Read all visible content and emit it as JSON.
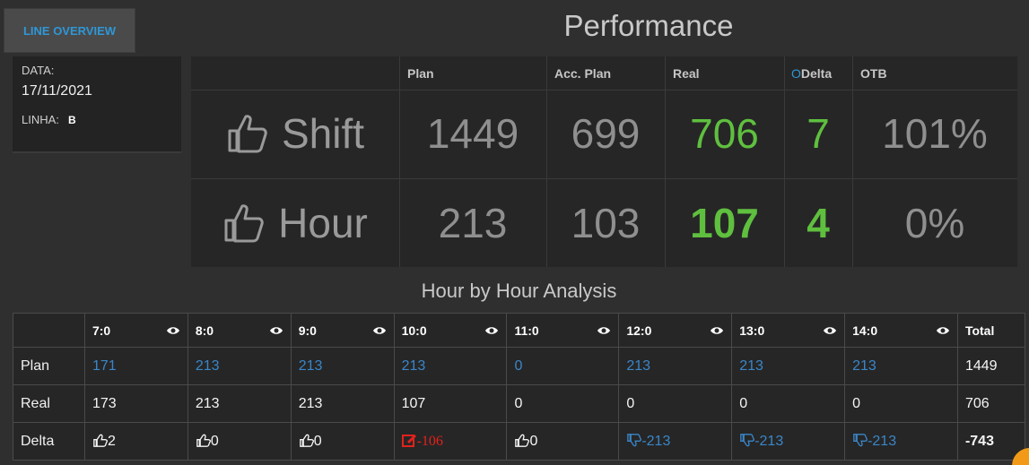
{
  "nav": {
    "overview_label": "LINE OVERVIEW"
  },
  "title": "Performance",
  "info": {
    "data_label": "DATA:",
    "data_value": "17/11/2021",
    "linha_label": "LINHA:",
    "linha_value": "B"
  },
  "performance": {
    "columns": [
      "Plan",
      "Acc. Plan",
      "Real",
      "Delta",
      "OTB"
    ],
    "delta_prefix": "O",
    "rows": [
      {
        "name": "Shift",
        "plan": "1449",
        "acc_plan": "699",
        "real": "706",
        "delta": "7",
        "otb": "101%"
      },
      {
        "name": "Hour",
        "plan": "213",
        "acc_plan": "103",
        "real": "107",
        "delta": "4",
        "otb": "0%"
      }
    ]
  },
  "hourly": {
    "title": "Hour by Hour Analysis",
    "hours": [
      "7:0",
      "8:0",
      "9:0",
      "10:0",
      "11:0",
      "12:0",
      "13:0",
      "14:0"
    ],
    "total_label": "Total",
    "rows": {
      "plan": {
        "label": "Plan",
        "values": [
          "171",
          "213",
          "213",
          "213",
          "0",
          "213",
          "213",
          "213"
        ],
        "total": "1449"
      },
      "real": {
        "label": "Real",
        "values": [
          "173",
          "213",
          "213",
          "107",
          "0",
          "0",
          "0",
          "0"
        ],
        "total": "706"
      },
      "delta": {
        "label": "Delta",
        "values": [
          "2",
          "0",
          "0",
          "-106",
          "0",
          "-213",
          "-213",
          "-213"
        ],
        "status": [
          "up",
          "up",
          "up",
          "alert",
          "up",
          "down",
          "down",
          "down"
        ],
        "total": "-743"
      }
    }
  },
  "colors": {
    "accent_blue": "#2f97d6",
    "plan_blue": "#3a86c8",
    "good_green": "#5fbf3f",
    "bad_red": "#e3211c"
  }
}
